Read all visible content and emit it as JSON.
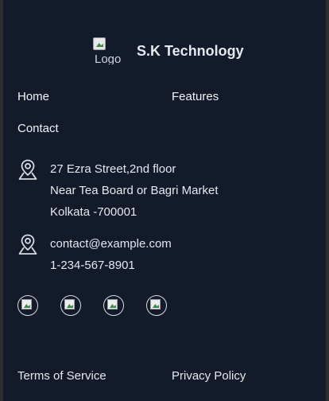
{
  "brand": {
    "logo_alt": "Logo",
    "name": "S.K Technology"
  },
  "nav": {
    "home": "Home",
    "features": "Features",
    "contact": "Contact"
  },
  "address": {
    "icon": "location-pin-icon",
    "line1": "27 Ezra Street,2nd floor",
    "line2": "Near Tea Board or Bagri Market",
    "line3": "Kolkata -700001"
  },
  "contact": {
    "icon": "location-pin-icon",
    "email": "contact@example.com",
    "phone": "1-234-567-8901"
  },
  "socials": [
    {
      "icon": "broken-image-icon"
    },
    {
      "icon": "broken-image-icon"
    },
    {
      "icon": "broken-image-icon"
    },
    {
      "icon": "broken-image-icon"
    }
  ],
  "footer": {
    "terms": "Terms of Service",
    "privacy": "Privacy Policy"
  }
}
